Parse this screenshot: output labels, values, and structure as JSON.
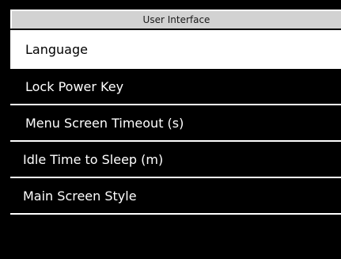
{
  "title_bar": {
    "title": "User Interface"
  },
  "menu": {
    "selected_index": 0,
    "items": [
      {
        "label": "Language"
      },
      {
        "label": "Lock Power Key"
      },
      {
        "label": "Menu Screen Timeout (s)"
      },
      {
        "label": "Idle Time to Sleep (m)"
      },
      {
        "label": "Main Screen Style"
      }
    ]
  },
  "colors": {
    "background": "#000000",
    "title_bar": "#d2d2d2",
    "selected_bg": "#ffffff",
    "text": "#ffffff",
    "divider": "#ffffff"
  }
}
